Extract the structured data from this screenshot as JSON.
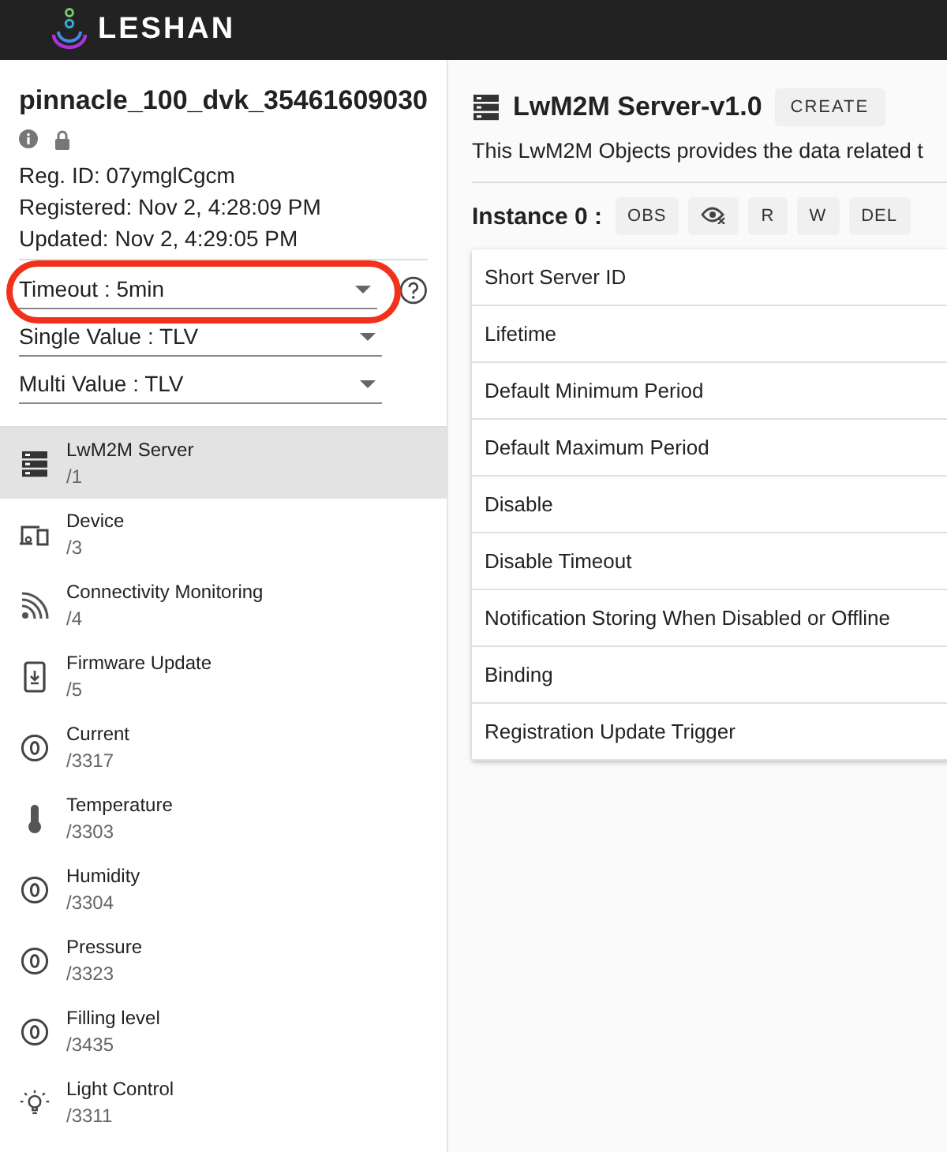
{
  "header": {
    "brand": "LESHAN"
  },
  "client": {
    "endpoint": "pinnacle_100_dvk_35461609030",
    "reg_id": "Reg. ID: 07ymglCgcm",
    "registered": "Registered: Nov 2, 4:28:09 PM",
    "updated": "Updated: Nov 2, 4:29:05 PM"
  },
  "settings": [
    {
      "label": "Timeout : 5min",
      "highlighted": true,
      "help": true
    },
    {
      "label": "Single Value : TLV",
      "highlighted": false,
      "help": false
    },
    {
      "label": "Multi Value : TLV",
      "highlighted": false,
      "help": false
    }
  ],
  "objects": [
    {
      "name": "LwM2M Server",
      "path": "/1",
      "kind": "server",
      "selected": true
    },
    {
      "name": "Device",
      "path": "/3",
      "kind": "device",
      "selected": false
    },
    {
      "name": "Connectivity Monitoring",
      "path": "/4",
      "kind": "signal",
      "selected": false
    },
    {
      "name": "Firmware Update",
      "path": "/5",
      "kind": "firmware",
      "selected": false
    },
    {
      "name": "Current",
      "path": "/3317",
      "kind": "sensor",
      "selected": false
    },
    {
      "name": "Temperature",
      "path": "/3303",
      "kind": "thermometer",
      "selected": false
    },
    {
      "name": "Humidity",
      "path": "/3304",
      "kind": "sensor",
      "selected": false
    },
    {
      "name": "Pressure",
      "path": "/3323",
      "kind": "sensor",
      "selected": false
    },
    {
      "name": "Filling level",
      "path": "/3435",
      "kind": "sensor",
      "selected": false
    },
    {
      "name": "Light Control",
      "path": "/3311",
      "kind": "light",
      "selected": false
    }
  ],
  "object": {
    "title": "LwM2M Server-v1.0",
    "create_button": "CREATE",
    "description": "This LwM2M Objects provides the data related t"
  },
  "instance": {
    "label": "Instance 0 :",
    "buttons": [
      {
        "kind": "text",
        "label": "OBS"
      },
      {
        "kind": "observe-cancel"
      },
      {
        "kind": "text",
        "label": "R"
      },
      {
        "kind": "text",
        "label": "W"
      },
      {
        "kind": "text",
        "label": "DEL"
      }
    ],
    "resources": [
      "Short Server ID",
      "Lifetime",
      "Default Minimum Period",
      "Default Maximum Period",
      "Disable",
      "Disable Timeout",
      "Notification Storing When Disabled or Offline",
      "Binding",
      "Registration Update Trigger"
    ]
  }
}
